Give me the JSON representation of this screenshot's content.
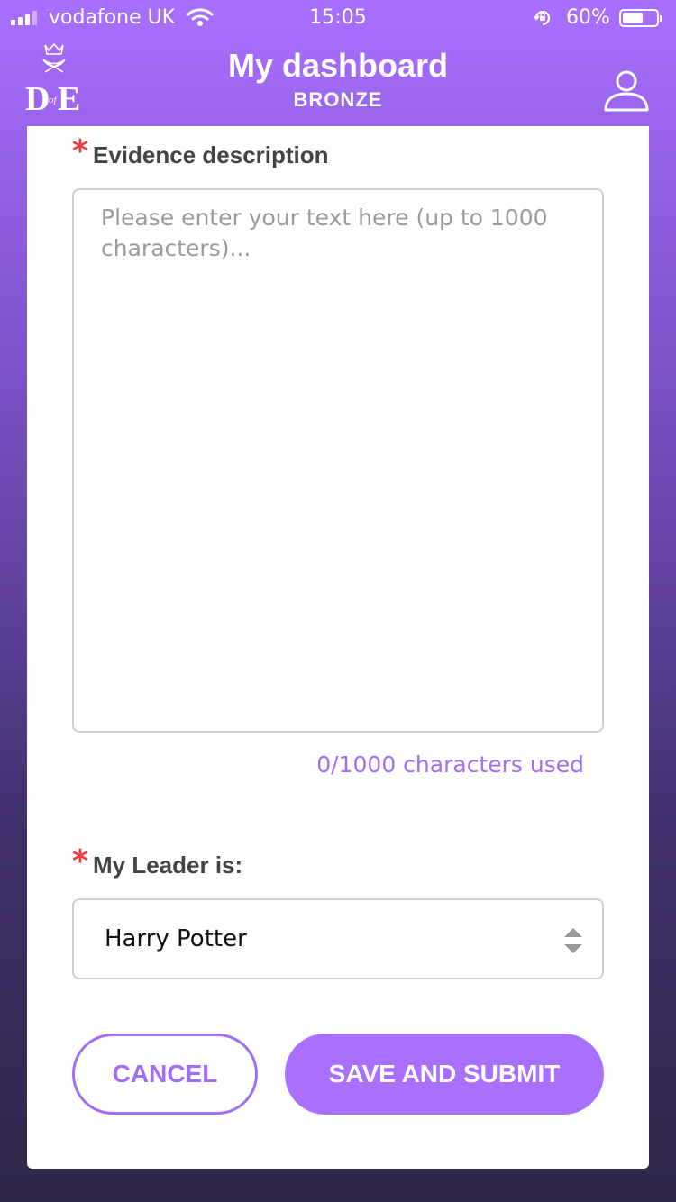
{
  "status_bar": {
    "carrier": "vodafone UK",
    "time": "15:05",
    "battery_percent": "60%",
    "battery_level": 0.6,
    "signal_bars": 3,
    "icons": [
      "signal-icon",
      "wifi-icon",
      "rotation-lock-icon",
      "battery-icon"
    ]
  },
  "header": {
    "title": "My dashboard",
    "subtitle": "BRONZE",
    "logo_text": "DofE",
    "profile_icon": "user-profile-icon"
  },
  "form": {
    "evidence": {
      "label": "Evidence description",
      "required_marker": "*",
      "value": "",
      "placeholder": "Please enter your text here (up to 1000 characters)...",
      "counter": "0/1000 characters used"
    },
    "leader": {
      "label": "My Leader is:",
      "required_marker": "*",
      "selected": "Harry Potter"
    },
    "buttons": {
      "cancel": "CANCEL",
      "submit": "SAVE AND SUBMIT"
    }
  },
  "colors": {
    "accent": "#a970ff",
    "accent_text": "#a46df5",
    "required": "#ef3b3b"
  }
}
